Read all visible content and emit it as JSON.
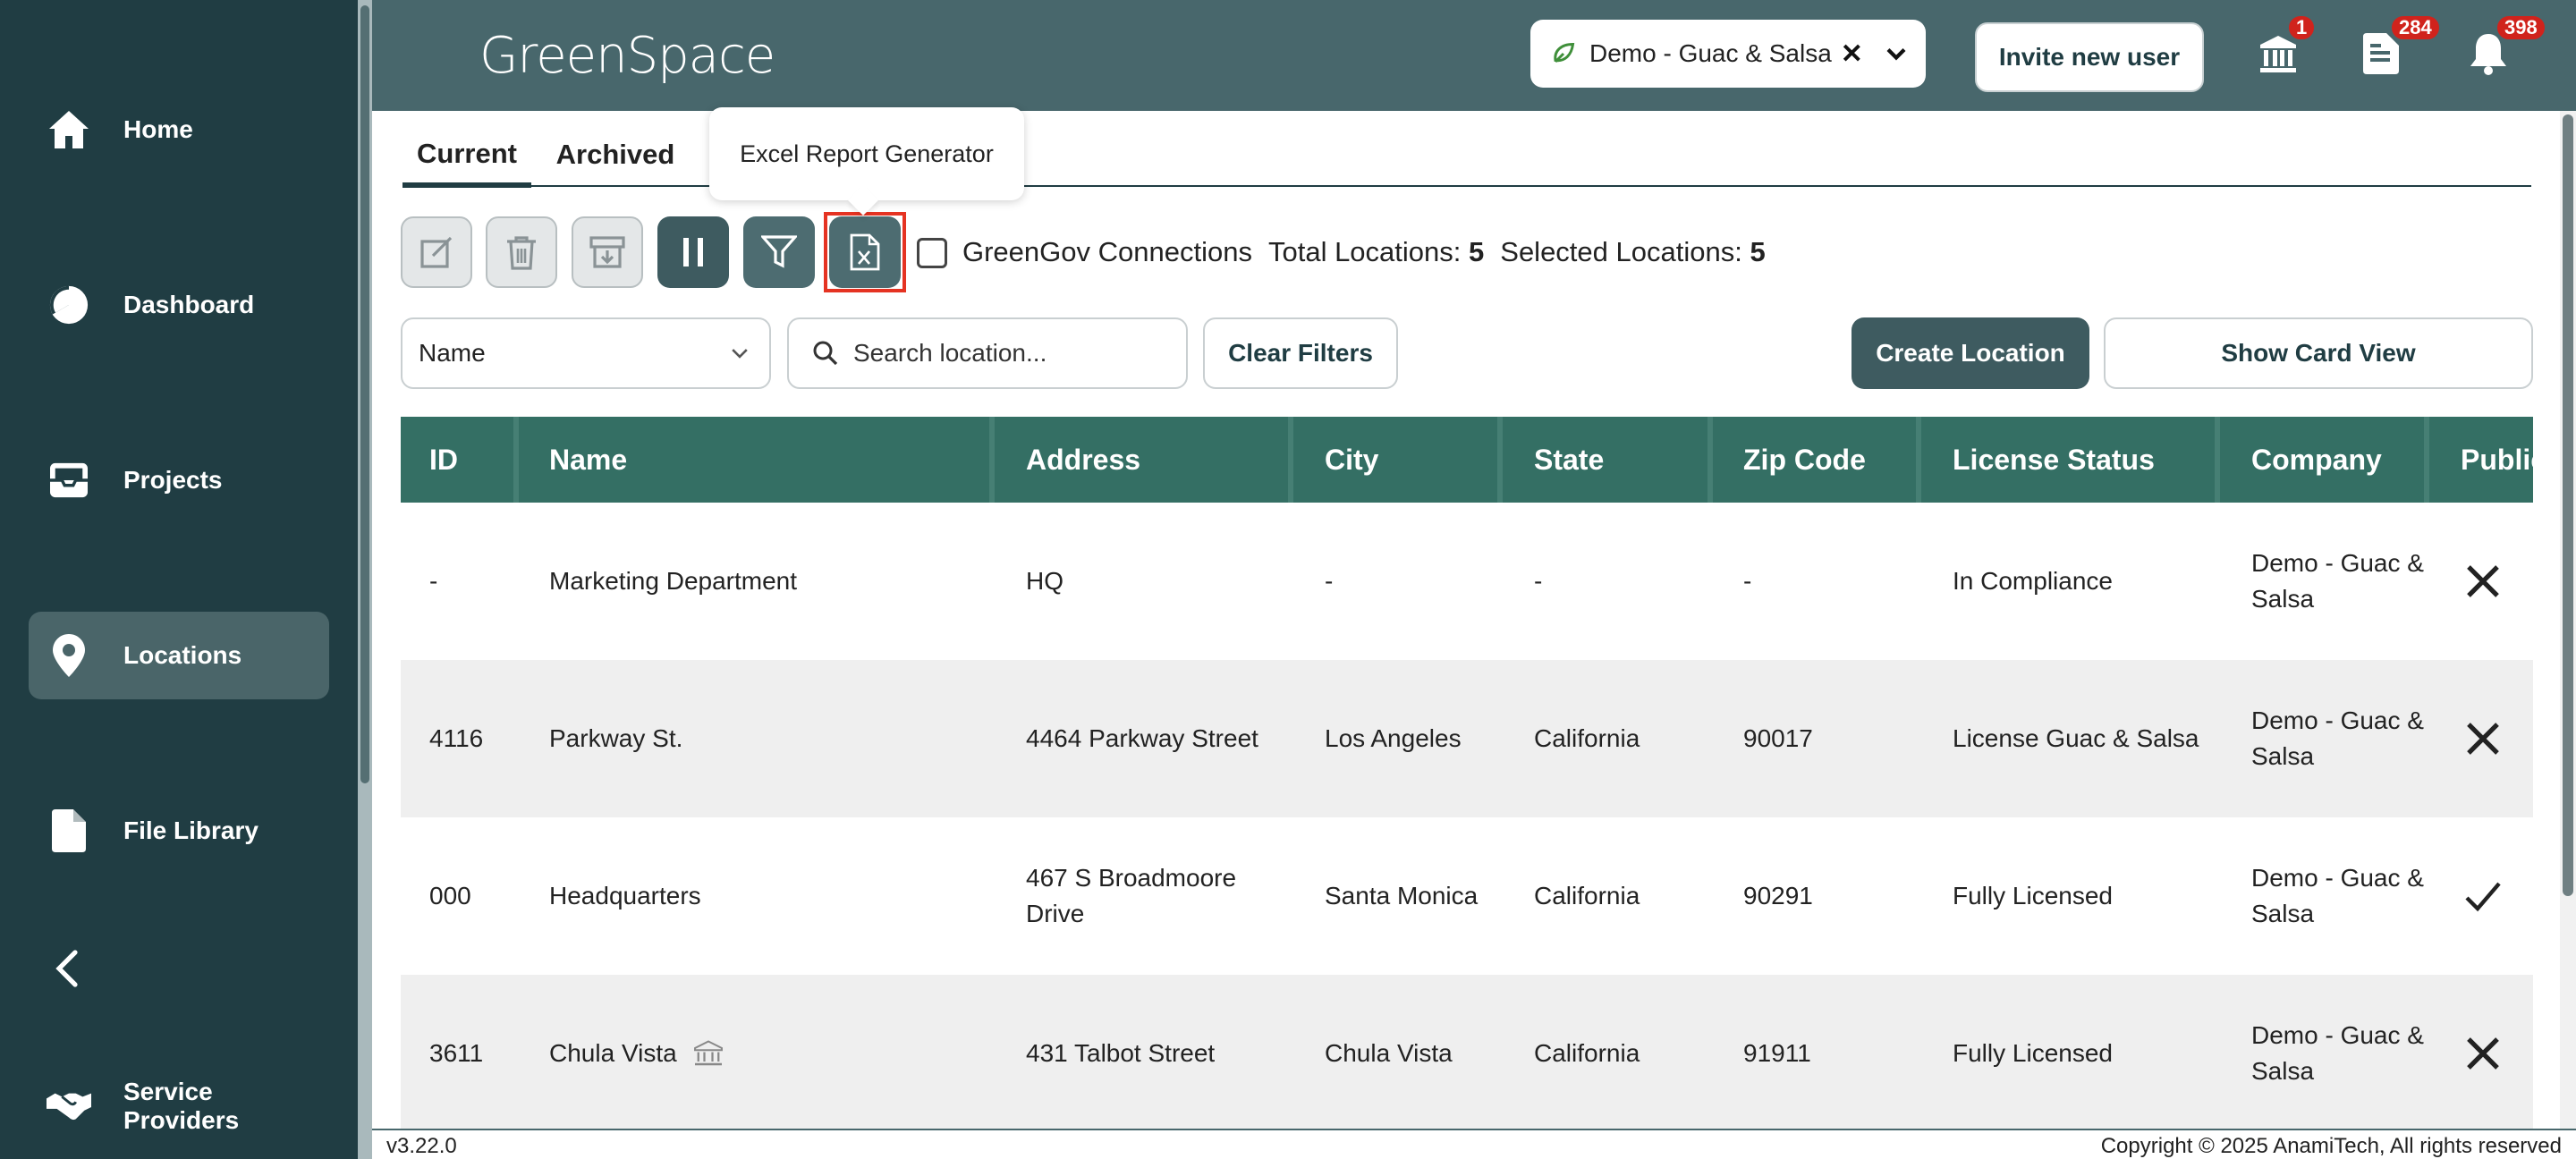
{
  "app": {
    "logo_text": "GreenSpace",
    "version": "v3.22.0",
    "copyright": "Copyright © 2025 AnamiTech, All rights reserved"
  },
  "sidebar": {
    "items": [
      {
        "label": "Home",
        "icon": "home-icon"
      },
      {
        "label": "Dashboard",
        "icon": "pie-chart-icon"
      },
      {
        "label": "Projects",
        "icon": "inbox-tray-icon"
      },
      {
        "label": "Locations",
        "icon": "map-pin-icon",
        "active": true
      },
      {
        "label": "File Library",
        "icon": "file-icon"
      },
      {
        "label": "Service Providers",
        "icon": "handshake-icon"
      }
    ]
  },
  "header": {
    "company_select": {
      "value": "Demo - Guac & Salsa"
    },
    "invite_label": "Invite new user",
    "badges": {
      "govt": "1",
      "documents": "284",
      "notifications": "398"
    }
  },
  "tabs": [
    {
      "label": "Current",
      "active": true
    },
    {
      "label": "Archived",
      "active": false
    }
  ],
  "tooltip": "Excel Report Generator",
  "toolbar": {
    "greengov_label": "GreenGov Connections",
    "total_label": "Total Locations:",
    "total_value": "5",
    "selected_label": "Selected Locations:",
    "selected_value": "5"
  },
  "filters": {
    "sort_value": "Name",
    "search_placeholder": "Search location...",
    "clear_label": "Clear Filters",
    "create_label": "Create Location",
    "card_view_label": "Show Card View"
  },
  "table": {
    "columns": [
      "ID",
      "Name",
      "Address",
      "City",
      "State",
      "Zip Code",
      "License Status",
      "Company",
      "Public"
    ],
    "rows": [
      {
        "id": "-",
        "name": "Marketing Department",
        "address": "HQ",
        "city": "-",
        "state": "-",
        "zip": "-",
        "license": "In Compliance",
        "company": "Demo - Guac & Salsa",
        "public": "no",
        "govt": false
      },
      {
        "id": "4116",
        "name": "Parkway St.",
        "address": "4464 Parkway Street",
        "city": "Los Angeles",
        "state": "California",
        "zip": "90017",
        "license": "License Guac & Salsa",
        "company": "Demo - Guac & Salsa",
        "public": "no",
        "govt": false
      },
      {
        "id": "000",
        "name": "Headquarters",
        "address": "467 S Broadmoore Drive",
        "city": "Santa Monica",
        "state": "California",
        "zip": "90291",
        "license": "Fully Licensed",
        "company": "Demo - Guac & Salsa",
        "public": "yes",
        "govt": false
      },
      {
        "id": "3611",
        "name": "Chula Vista",
        "address": "431 Talbot Street",
        "city": "Chula Vista",
        "state": "California",
        "zip": "91911",
        "license": "Fully Licensed",
        "company": "Demo - Guac & Salsa",
        "public": "no",
        "govt": true
      }
    ]
  },
  "colors": {
    "sidebar_bg": "#203d43",
    "header_bg": "#48676c",
    "table_header_bg": "#346f64",
    "primary_button": "#3e5b60",
    "badge_red": "#d0231c",
    "highlight_red": "#e53322"
  }
}
